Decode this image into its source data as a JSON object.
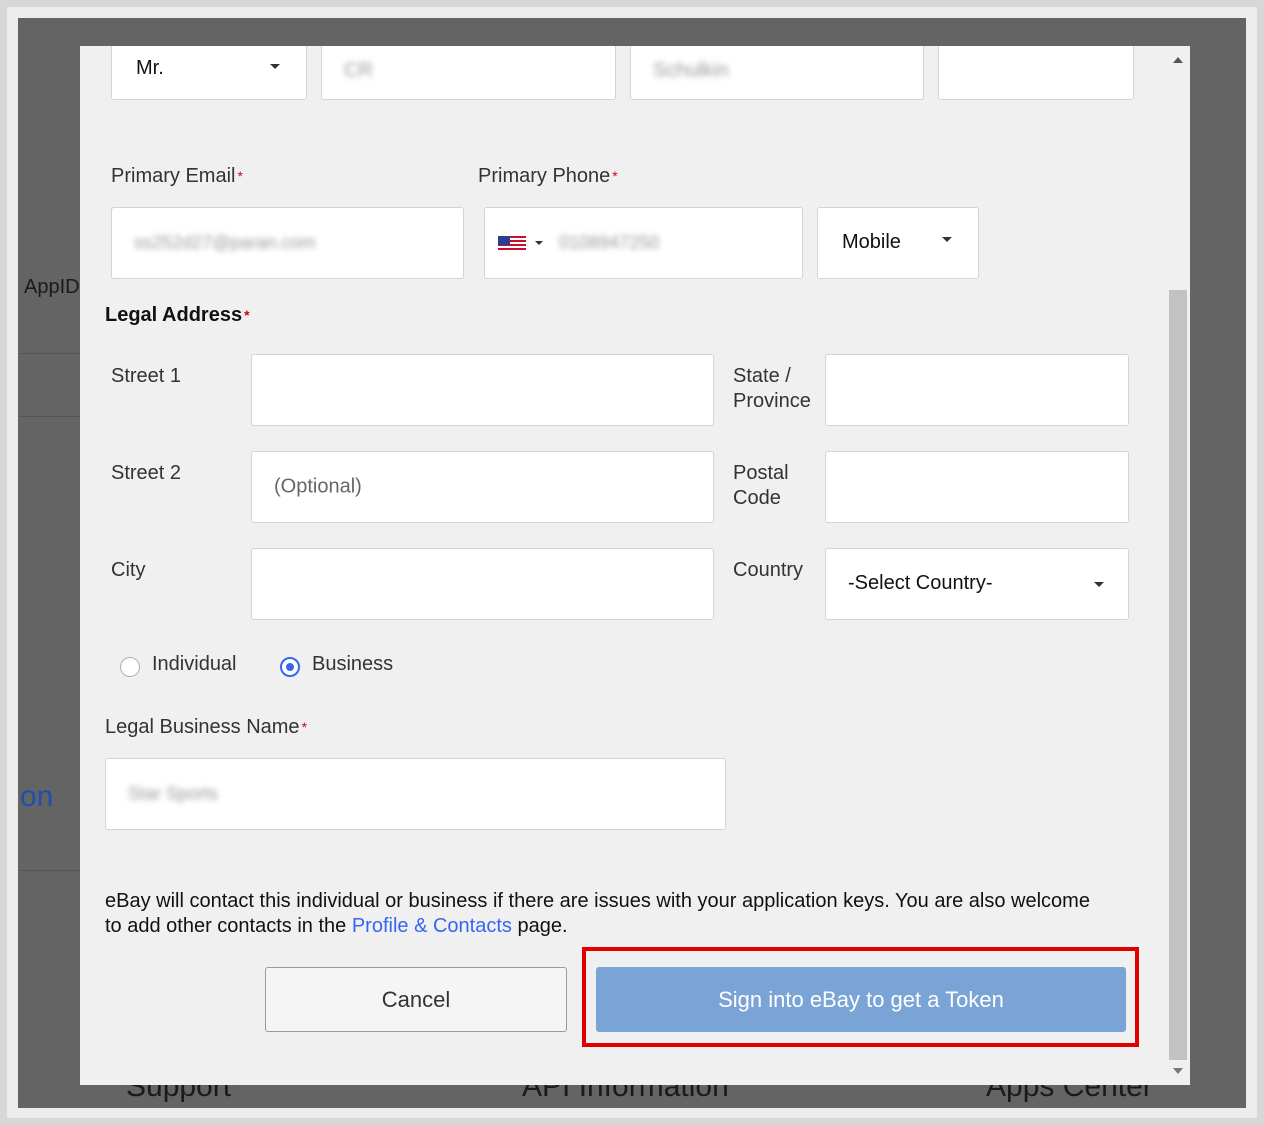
{
  "background": {
    "appid_fragment": "AppID",
    "link_fragment": "on",
    "footer": [
      "Support",
      "API Information",
      "Apps Center"
    ]
  },
  "form": {
    "salutation": "Mr.",
    "first_name": "CR",
    "last_name": "Schulkin",
    "email_label": "Primary Email",
    "email_value": "ss252d27@paran.com",
    "phone_label": "Primary Phone",
    "phone_value": "0108947250",
    "phone_type": "Mobile",
    "legal_address_label": "Legal Address",
    "street1_label": "Street 1",
    "street2_label": "Street 2",
    "street2_placeholder": "(Optional)",
    "city_label": "City",
    "state_label_1": "State /",
    "state_label_2": "Province",
    "postal_label_1": "Postal",
    "postal_label_2": "Code",
    "country_label": "Country",
    "country_value": "-Select Country-",
    "radio_individual": "Individual",
    "radio_business": "Business",
    "selected_type": "Business",
    "business_name_label": "Legal Business Name",
    "business_name_value": "Star Sports",
    "notice_text": "eBay will contact this individual or business if there are issues with your application keys. You are also welcome to add other contacts in the ",
    "notice_link": "Profile & Contacts",
    "notice_suffix": " page.",
    "cancel_label": "Cancel",
    "submit_label": "Sign into eBay to get a Token"
  },
  "colors": {
    "primary_button": "#7aa3d6",
    "link": "#3665f3",
    "required": "#d0021b",
    "highlight": "#e00000"
  }
}
